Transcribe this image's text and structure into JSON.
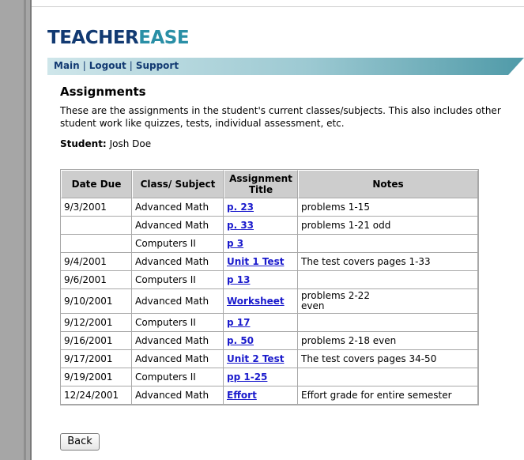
{
  "logo": {
    "part1": "TEACHER",
    "part2": "EASE"
  },
  "nav": {
    "items": [
      {
        "label": "Main"
      },
      {
        "label": "Logout"
      },
      {
        "label": "Support"
      }
    ],
    "separator": "|"
  },
  "page": {
    "title": "Assignments",
    "description": "These are the assignments in the student's current classes/subjects. This also includes other student work like quizzes, tests, individual assessment, etc.",
    "student_label": "Student:",
    "student_name": "Josh Doe"
  },
  "table": {
    "headers": {
      "date": "Date Due",
      "class": "Class/ Subject",
      "title": "Assignment Title",
      "notes": "Notes"
    },
    "rows": [
      {
        "date": "9/3/2001",
        "class": "Advanced Math",
        "title": "p. 23",
        "notes": "problems 1-15"
      },
      {
        "date": "",
        "class": "Advanced Math",
        "title": "p. 33",
        "notes": "problems 1-21 odd"
      },
      {
        "date": "",
        "class": "Computers II",
        "title": "p 3",
        "notes": ""
      },
      {
        "date": "9/4/2001",
        "class": "Advanced Math",
        "title": "Unit 1 Test",
        "notes": "The test covers pages 1-33"
      },
      {
        "date": "9/6/2001",
        "class": "Computers II",
        "title": "p 13",
        "notes": ""
      },
      {
        "date": "9/10/2001",
        "class": "Advanced Math",
        "title": "Worksheet",
        "notes": "problems 2-22 even"
      },
      {
        "date": "9/12/2001",
        "class": "Computers II",
        "title": "p 17",
        "notes": ""
      },
      {
        "date": "9/16/2001",
        "class": "Advanced Math",
        "title": "p. 50",
        "notes": "problems 2-18 even"
      },
      {
        "date": "9/17/2001",
        "class": "Advanced Math",
        "title": "Unit 2 Test",
        "notes": "The test covers pages 34-50"
      },
      {
        "date": "9/19/2001",
        "class": "Computers II",
        "title": "pp 1-25",
        "notes": ""
      },
      {
        "date": "12/24/2001",
        "class": "Advanced Math",
        "title": "Effort",
        "notes": "Effort grade for entire semester"
      }
    ]
  },
  "back_button": {
    "label": "Back"
  },
  "colors": {
    "brand_dark": "#123a72",
    "brand_teal": "#2a8fa6",
    "link": "#1a1acc",
    "header_bg": "#cdcdcd"
  }
}
